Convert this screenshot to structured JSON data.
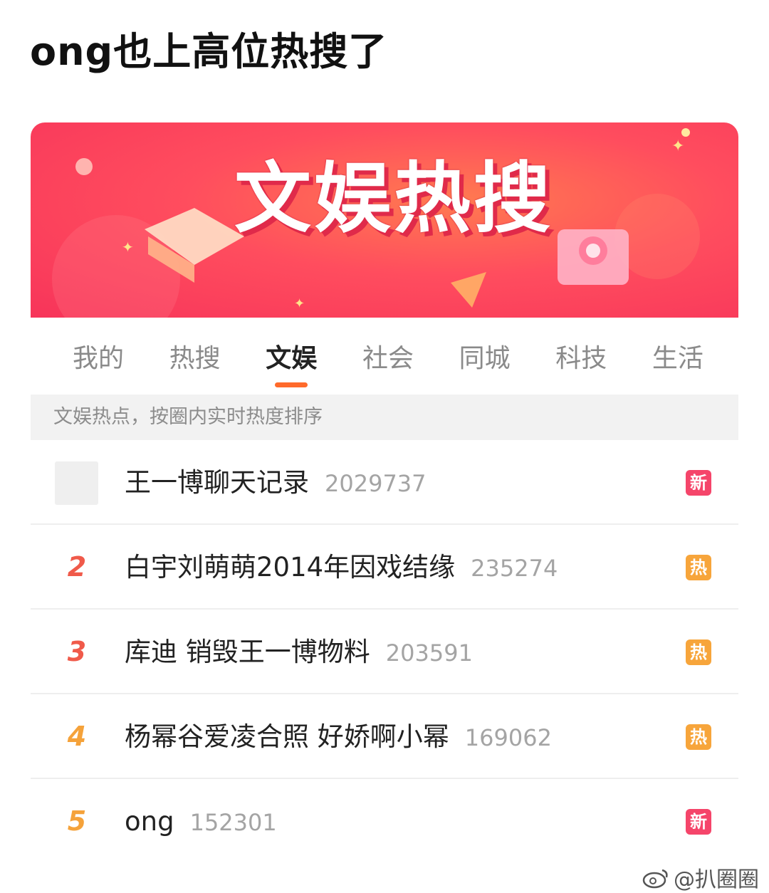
{
  "post_title": "ong也上高位热搜了",
  "banner": {
    "title": "文娱热搜"
  },
  "tabs": [
    {
      "label": "我的",
      "active": false
    },
    {
      "label": "热搜",
      "active": false
    },
    {
      "label": "文娱",
      "active": true
    },
    {
      "label": "社会",
      "active": false
    },
    {
      "label": "同城",
      "active": false
    },
    {
      "label": "科技",
      "active": false
    },
    {
      "label": "生活",
      "active": false
    }
  ],
  "subheader": "文娱热点，按圈内实时热度排序",
  "list": [
    {
      "rank": "",
      "pinned": true,
      "topic": "王一博聊天记录",
      "count": "2029737",
      "badge": "新",
      "badge_type": "new"
    },
    {
      "rank": "2",
      "rank_color": "#f05a4a",
      "topic": "白宇刘萌萌2014年因戏结缘",
      "count": "235274",
      "badge": "热",
      "badge_type": "hot"
    },
    {
      "rank": "3",
      "rank_color": "#f05a4a",
      "topic": "库迪 销毁王一博物料",
      "count": "203591",
      "badge": "热",
      "badge_type": "hot"
    },
    {
      "rank": "4",
      "rank_color": "#f5a23a",
      "topic": "杨幂谷爱凌合照 好娇啊小幂",
      "count": "169062",
      "badge": "热",
      "badge_type": "hot"
    },
    {
      "rank": "5",
      "rank_color": "#f5a23a",
      "topic": "ong",
      "count": "152301",
      "badge": "新",
      "badge_type": "new"
    }
  ],
  "watermark": {
    "icon": "weibo-icon",
    "text": "@扒圈圈"
  },
  "colors": {
    "new_badge": "#f5456a",
    "hot_badge": "#f7a53b",
    "tab_accent": "#ff6a2b"
  }
}
